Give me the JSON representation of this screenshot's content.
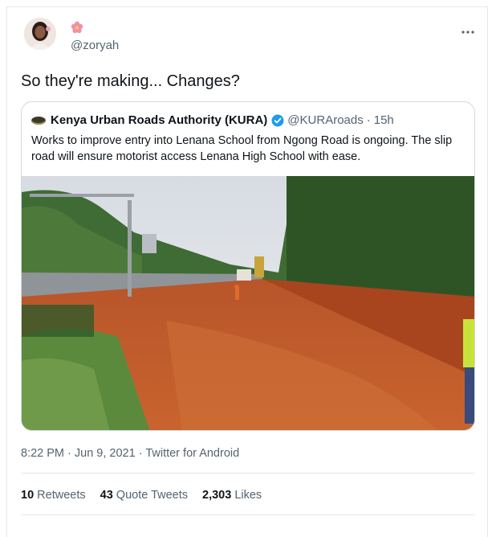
{
  "tweet": {
    "handle": "@zoryah",
    "text": "So they're making... Changes?",
    "more_icon": "more-horizontal-icon",
    "timestamp": "8:22 PM · Jun 9, 2021",
    "source": "Twitter for Android",
    "retweets_count": "10",
    "retweets_label": "Retweets",
    "quote_count": "43",
    "quote_label": "Quote Tweets",
    "likes_count": "2,303",
    "likes_label": "Likes"
  },
  "quoted": {
    "name": "Kenya Urban Roads Authority (KURA)",
    "handle": "@KURAroads",
    "time": "15h",
    "text": "Works to improve entry into Lenana School from Ngong Road is ongoing. The slip road will ensure motorist access Lenana High School with ease.",
    "verified_icon": "verified-badge-icon"
  },
  "colors": {
    "text": "#0f1419",
    "secondary": "#536471",
    "border": "#e1e8ed",
    "verified": "#1d9bf0"
  }
}
